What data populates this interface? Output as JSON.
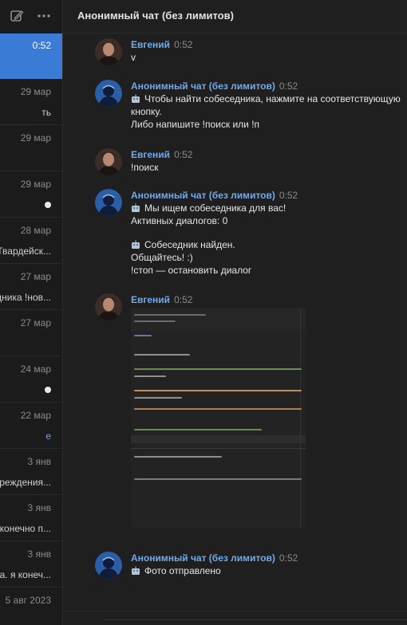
{
  "sidebar": {
    "items": [
      {
        "time": "0:52",
        "preview": ""
      },
      {
        "time": "29 мар",
        "preview": "ть"
      },
      {
        "time": "29 мар",
        "preview": ""
      },
      {
        "time": "29 мар",
        "preview": ""
      },
      {
        "time": "28 мар",
        "preview": "Твардейск..."
      },
      {
        "time": "27 мар",
        "preview": "дника !нов..."
      },
      {
        "time": "27 мар",
        "preview": ""
      },
      {
        "time": "24 мар",
        "preview": ""
      },
      {
        "time": "22 мар",
        "preview": "е"
      },
      {
        "time": "3 янв",
        "preview": "реждения..."
      },
      {
        "time": "3 янв",
        "preview": "конечно п..."
      },
      {
        "time": "3 янв",
        "preview": "а. я конеч..."
      },
      {
        "time": "5 авг 2023",
        "preview": ""
      }
    ]
  },
  "header": {
    "title": "Анонимный чат (без лимитов)"
  },
  "messages": [
    {
      "sender": "Евгений",
      "time": "0:52",
      "lines": [
        "v"
      ]
    },
    {
      "sender": "Анонимный чат (без лимитов)",
      "time": "0:52",
      "lines": [
        "Чтобы найти собеседника, нажмите на соответствующую",
        "кнопку.",
        "Либо напишите !поиск или !п"
      ]
    },
    {
      "sender": "Евгений",
      "time": "0:52",
      "lines": [
        "!поиск"
      ]
    },
    {
      "sender": "Анонимный чат (без лимитов)",
      "time": "0:52",
      "lines": [
        "Мы ищем собеседника для вас!",
        "Активных диалогов: 0",
        "Собеседник найден.",
        "Общайтесь! :)",
        "!стоп — остановить диалог"
      ]
    },
    {
      "sender": "Евгений",
      "time": "0:52",
      "lines": []
    },
    {
      "sender": "Анонимный чат (без лимитов)",
      "time": "0:52",
      "lines": [
        "Фото отправлено"
      ]
    }
  ],
  "colors": {
    "accent": "#3a7bd5",
    "sender": "#71aaeb",
    "background": "#1f1f1f"
  },
  "icons": {
    "toolbar": [
      "compose-icon",
      "more-icon"
    ],
    "bot_emoji": "robot-emoji-icon"
  }
}
